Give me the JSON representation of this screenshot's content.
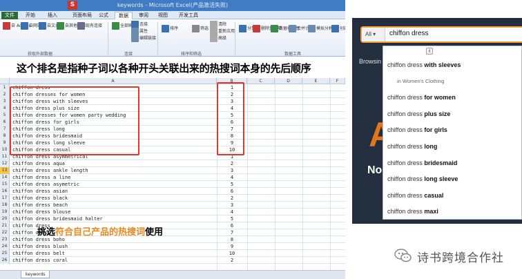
{
  "excel": {
    "title_text": "keywords - Microsoft Excel(产品激活失败)",
    "qa_letter": "S",
    "tabs": [
      "文件",
      "开始",
      "插入",
      "页面布局",
      "公式",
      "数据",
      "审阅",
      "视图",
      "开发工具"
    ],
    "ribbon": {
      "buttons": [
        "自 Access",
        "自网站",
        "自文本",
        "自其他来源",
        "现有连接",
        "全部刷新",
        "连接",
        "属性",
        "编辑链接",
        "排序",
        "筛选",
        "清除",
        "重新应用",
        "高级",
        "分列",
        "删除重复项",
        "数据有效性",
        "合并计算",
        "模拟分析",
        "创建组"
      ],
      "groups": [
        "获取外部数据",
        "连接",
        "排序和筛选",
        "数据工具"
      ]
    },
    "name_box": "A13",
    "col_headers": [
      "A",
      "B",
      "C",
      "D",
      "E",
      "F"
    ],
    "rows": [
      {
        "n": "1",
        "a": "chiffon dress",
        "b": "1"
      },
      {
        "n": "2",
        "a": "chiffon dresses for women",
        "b": "2"
      },
      {
        "n": "3",
        "a": "chiffon dress with sleeves",
        "b": "3"
      },
      {
        "n": "4",
        "a": "chiffon dress plus size",
        "b": "4"
      },
      {
        "n": "5",
        "a": "chiffon dresses for women party wedding",
        "b": "5"
      },
      {
        "n": "6",
        "a": "chiffon dress for girls",
        "b": "6"
      },
      {
        "n": "7",
        "a": "chiffon dress long",
        "b": "7"
      },
      {
        "n": "8",
        "a": "chiffon dress bridesmaid",
        "b": "8"
      },
      {
        "n": "9",
        "a": "chiffon dress long sleeve",
        "b": "9"
      },
      {
        "n": "10",
        "a": "chiffon dress casual",
        "b": "10"
      },
      {
        "n": "11",
        "a": "chiffon dress asymmetrical",
        "b": "1"
      },
      {
        "n": "12",
        "a": "chiffon dress aqua",
        "b": "2"
      },
      {
        "n": "13",
        "a": "chiffon dress ankle length",
        "b": "3"
      },
      {
        "n": "14",
        "a": "chiffon dress a line",
        "b": "4"
      },
      {
        "n": "15",
        "a": "chiffon dress asymetric",
        "b": "5"
      },
      {
        "n": "16",
        "a": "chiffon dress asian",
        "b": "6"
      },
      {
        "n": "17",
        "a": "chiffon dress black",
        "b": "2"
      },
      {
        "n": "18",
        "a": "chiffon dress beach",
        "b": "3"
      },
      {
        "n": "19",
        "a": "chiffon dress blouse",
        "b": "4"
      },
      {
        "n": "20",
        "a": "chiffon dress bridesmaid halter",
        "b": "5"
      },
      {
        "n": "21",
        "a": "chiffon dress",
        "b": "6"
      },
      {
        "n": "22",
        "a": "chiffon dress",
        "b": "7"
      },
      {
        "n": "23",
        "a": "chiffon dress boho",
        "b": "8"
      },
      {
        "n": "24",
        "a": "chiffon dress blush",
        "b": "9"
      },
      {
        "n": "25",
        "a": "chiffon dress belt",
        "b": "10"
      },
      {
        "n": "26",
        "a": "chiffon dress coral",
        "b": "2"
      }
    ],
    "selected_row": "13",
    "sheet_tab": "keywords"
  },
  "banner_text": "这个排名是指种子词以各种开头关联出来的热搜词本身的先后顺序",
  "note": {
    "part1": "挑选",
    "part2": "符合自己产品的热搜词",
    "part3": "使用"
  },
  "amazon": {
    "category": "All",
    "query": "chiffon dress",
    "browse_text": "Browsin",
    "big_letter": "A",
    "no_text": "No",
    "suggestions": [
      {
        "prefix": "chiffon dress",
        "bold": " with sleeves",
        "type": "sug"
      },
      {
        "prefix": "in Women's Clothing",
        "bold": "",
        "type": "sub"
      },
      {
        "prefix": "chiffon dress",
        "bold": " for women",
        "type": "sug"
      },
      {
        "prefix": "chiffon dress",
        "bold": " plus size",
        "type": "sug"
      },
      {
        "prefix": "chiffon dress",
        "bold": " for girls",
        "type": "sug"
      },
      {
        "prefix": "chiffon dress",
        "bold": " long",
        "type": "sug"
      },
      {
        "prefix": "chiffon dress",
        "bold": " bridesmaid",
        "type": "sug"
      },
      {
        "prefix": "chiffon dress",
        "bold": " long sleeve",
        "type": "sug"
      },
      {
        "prefix": "chiffon dress",
        "bold": " casual",
        "type": "sug"
      },
      {
        "prefix": "chiffon dress",
        "bold": " maxi",
        "type": "sug"
      }
    ]
  },
  "watermark": "诗书跨境合作社",
  "colors": {
    "highlight_box": "#e0362b",
    "note_accent": "#e68a1f",
    "amazon_dark": "#232f3e",
    "amazon_orange": "#e2761b"
  }
}
